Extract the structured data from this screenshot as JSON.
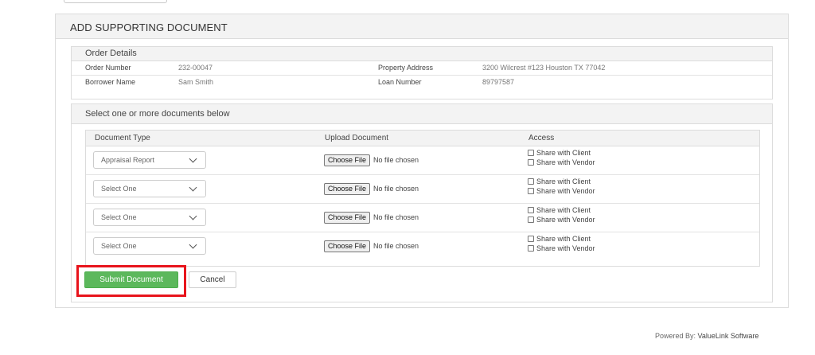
{
  "panel": {
    "title": "ADD SUPPORTING DOCUMENT"
  },
  "order_details": {
    "heading": "Order Details",
    "rows": [
      {
        "label1": "Order Number",
        "value1": "232-00047",
        "label2": "Property Address",
        "value2": "3200 Wilcrest #123 Houston TX 77042"
      },
      {
        "label1": "Borrower Name",
        "value1": "Sam Smith",
        "label2": "Loan Number",
        "value2": "89797587"
      }
    ]
  },
  "documents": {
    "heading": "Select one or more documents below",
    "columns": [
      "Document Type",
      "Upload Document",
      "Access"
    ],
    "rows": [
      {
        "type": "Appraisal Report",
        "file_button": "Choose File",
        "file_status": "No file chosen",
        "share_client": "Share with Client",
        "share_vendor": "Share with Vendor"
      },
      {
        "type": "Select One",
        "file_button": "Choose File",
        "file_status": "No file chosen",
        "share_client": "Share with Client",
        "share_vendor": "Share with Vendor"
      },
      {
        "type": "Select One",
        "file_button": "Choose File",
        "file_status": "No file chosen",
        "share_client": "Share with Client",
        "share_vendor": "Share with Vendor"
      },
      {
        "type": "Select One",
        "file_button": "Choose File",
        "file_status": "No file chosen",
        "share_client": "Share with Client",
        "share_vendor": "Share with Vendor"
      }
    ]
  },
  "actions": {
    "submit_label": "Submit Document",
    "cancel_label": "Cancel"
  },
  "footer": {
    "prefix": "Powered By:",
    "brand": "ValueLink Software"
  },
  "colors": {
    "submit_bg": "#5cb85c",
    "highlight": "#e8141c",
    "header_bg": "#f3f3f3"
  },
  "icons": {
    "select_arrow": "chevron-down-icon",
    "checkbox": "checkbox-icon"
  }
}
